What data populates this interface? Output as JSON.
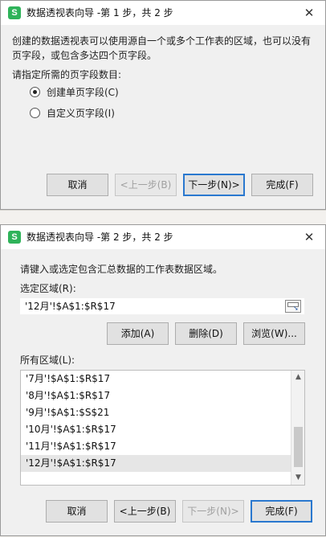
{
  "dialog1": {
    "title": "数据透视表向导 -第 1 步，共 2 步",
    "description": "创建的数据透视表可以使用源自一个或多个工作表的区域，也可以没有页字段，或包含多达四个页字段。",
    "prompt": "请指定所需的页字段数目:",
    "options": [
      {
        "label": "创建单页字段(C)",
        "checked": true
      },
      {
        "label": "自定义页字段(I)",
        "checked": false
      }
    ],
    "buttons": {
      "cancel": "取消",
      "back": "<上一步(B)",
      "next": "下一步(N)>",
      "finish": "完成(F)"
    }
  },
  "dialog2": {
    "title": "数据透视表向导 -第 2 步，共 2 步",
    "description": "请键入或选定包含汇总数据的工作表数据区域。",
    "range_label": "选定区域(R):",
    "range_value": "'12月'!$A$1:$R$17",
    "action_buttons": {
      "add": "添加(A)",
      "delete": "删除(D)",
      "browse": "浏览(W)..."
    },
    "all_ranges_label": "所有区域(L):",
    "ranges": [
      "'7月'!$A$1:$R$17",
      "'8月'!$A$1:$R$17",
      "'9月'!$A$1:$S$21",
      "'10月'!$A$1:$R$17",
      "'11月'!$A$1:$R$17",
      "'12月'!$A$1:$R$17"
    ],
    "selected_range_index": 5,
    "buttons": {
      "cancel": "取消",
      "back": "<上一步(B)",
      "next": "下一步(N)>",
      "finish": "完成(F)"
    }
  },
  "icons": {
    "app": "S",
    "close": "✕"
  },
  "colors": {
    "app_icon": "#2fb35a",
    "primary_border": "#2a78cf"
  }
}
